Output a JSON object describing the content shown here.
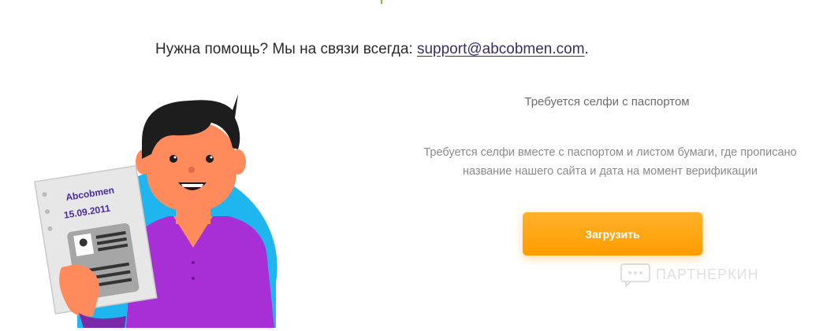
{
  "help": {
    "prefix": "Нужна помощь? Мы на связи всегда:",
    "email": "support@abcobmen.com",
    "suffix": "."
  },
  "illustration": {
    "brand": "Abcobmen",
    "date": "15.09.2011",
    "colors": {
      "circle": "#1fb6f0",
      "shirt": "#a82fd6",
      "skin": "#ff8a5c",
      "hair": "#1d1d1d"
    }
  },
  "requirement": {
    "title": "Требуется селфи с паспортом",
    "text_line1": "Требуется селфи вместе с паспортом и листом бумаги, где прописано",
    "text_line2": "название нашего сайта и дата на момент верификации"
  },
  "upload": {
    "label": "Загрузить",
    "color": "#ffa500"
  },
  "watermark": {
    "text": "ПАРТНЕРКИН"
  }
}
